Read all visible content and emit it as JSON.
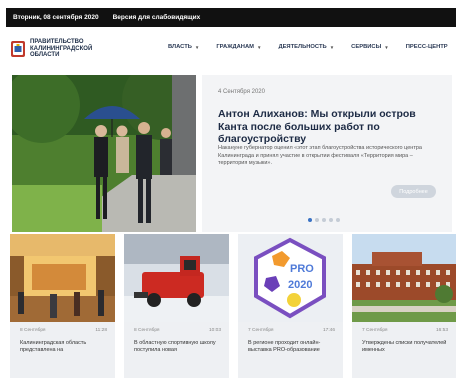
{
  "topbar": {
    "date": "Вторник, 08 сентября 2020",
    "accessibility": "Версия для слабовидящих"
  },
  "header": {
    "org_lines": [
      "ПРАВИТЕЛЬСТВО",
      "КАЛИНИНГРАДСКОЙ",
      "ОБЛАСТИ"
    ],
    "nav": [
      {
        "label": "ВЛАСТЬ"
      },
      {
        "label": "ГРАЖДАНАМ"
      },
      {
        "label": "ДЕЯТЕЛЬНОСТЬ"
      },
      {
        "label": "СЕРВИСЫ"
      },
      {
        "label": "ПРЕСС-ЦЕНТР"
      }
    ]
  },
  "hero": {
    "date": "4 Сентября 2020",
    "title": "Антон Алиханов: Мы открыли остров Канта после больших работ по благоустройству",
    "text": "Накануне губернатор оценил «этот этап благоустройства исторического центра Калининграда и принял участие в открытии фестиваля «Территория мира – территория музыки».",
    "button": "Подробнее"
  },
  "cards": [
    {
      "date": "8 Сентября",
      "time": "11:28",
      "text": "Калининградская область представлена на"
    },
    {
      "date": "8 Сентября",
      "time": "10:03",
      "text": "В областную спортивную школу поступила новая"
    },
    {
      "date": "7 Сентября",
      "time": "17:46",
      "text": "В регионе проходит онлайн-выставка PRO-образование"
    },
    {
      "date": "7 Сентября",
      "time": "16:53",
      "text": "Утверждены списки получателей именных"
    }
  ],
  "badge": {
    "line1": "PRO",
    "line2": "2020"
  },
  "colors": {
    "accent": "#3a72c4",
    "topbar": "#111111",
    "title": "#1c2a44",
    "card_bg": "#eef0f3"
  }
}
